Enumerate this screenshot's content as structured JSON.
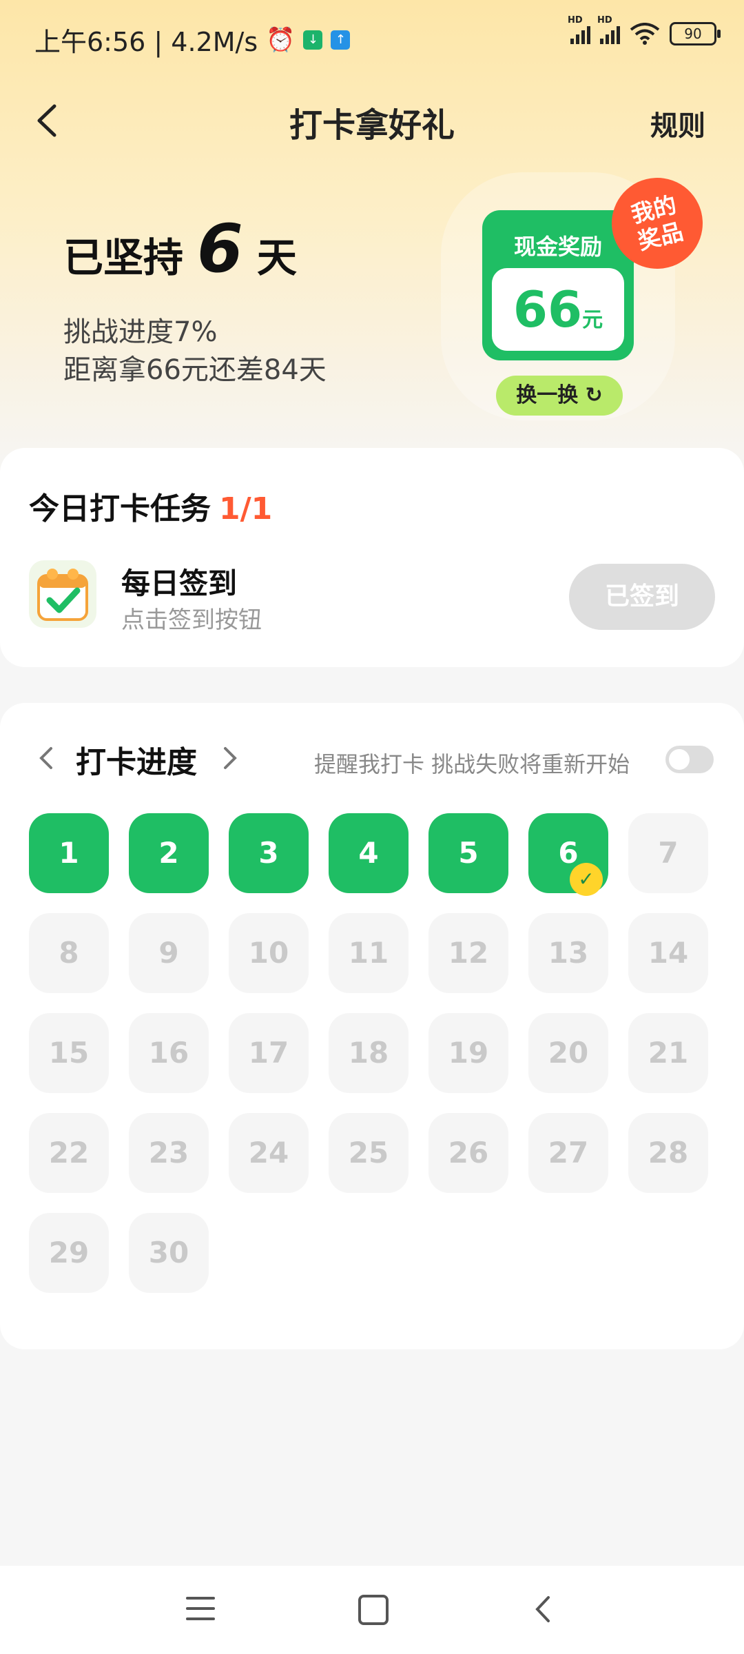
{
  "status_bar": {
    "time_speed": "上午6:56 | 4.2M/s",
    "network_hd1": "HD",
    "network_hd2": "HD",
    "battery": "90"
  },
  "header": {
    "title": "打卡拿好礼",
    "rules_label": "规则"
  },
  "summary": {
    "prefix": "已坚持",
    "days": "6",
    "suffix": "天",
    "progress_line": "挑战进度7%",
    "remaining_line": "距离拿66元还差84天"
  },
  "reward": {
    "label": "现金奖励",
    "amount": "66",
    "unit": "元",
    "my_prize_line1": "我的",
    "my_prize_line2": "奖品",
    "swap_label": "换一换"
  },
  "today_task": {
    "title": "今日打卡任务",
    "count": "1/1",
    "name": "每日签到",
    "subtitle": "点击签到按钮",
    "button_label": "已签到"
  },
  "progress": {
    "title": "打卡进度",
    "reminder_text": "提醒我打卡 挑战失败将重新开始",
    "reminder_enabled": false,
    "completed_days": 6,
    "total_days": 30,
    "days": [
      "1",
      "2",
      "3",
      "4",
      "5",
      "6",
      "7",
      "8",
      "9",
      "10",
      "11",
      "12",
      "13",
      "14",
      "15",
      "16",
      "17",
      "18",
      "19",
      "20",
      "21",
      "22",
      "23",
      "24",
      "25",
      "26",
      "27",
      "28",
      "29",
      "30"
    ]
  },
  "colors": {
    "accent_green": "#1fbe64",
    "accent_red": "#ff5a33",
    "hero_yellow": "#fde6a8"
  },
  "icons": {
    "today_mark": "✓",
    "refresh": "↻"
  }
}
